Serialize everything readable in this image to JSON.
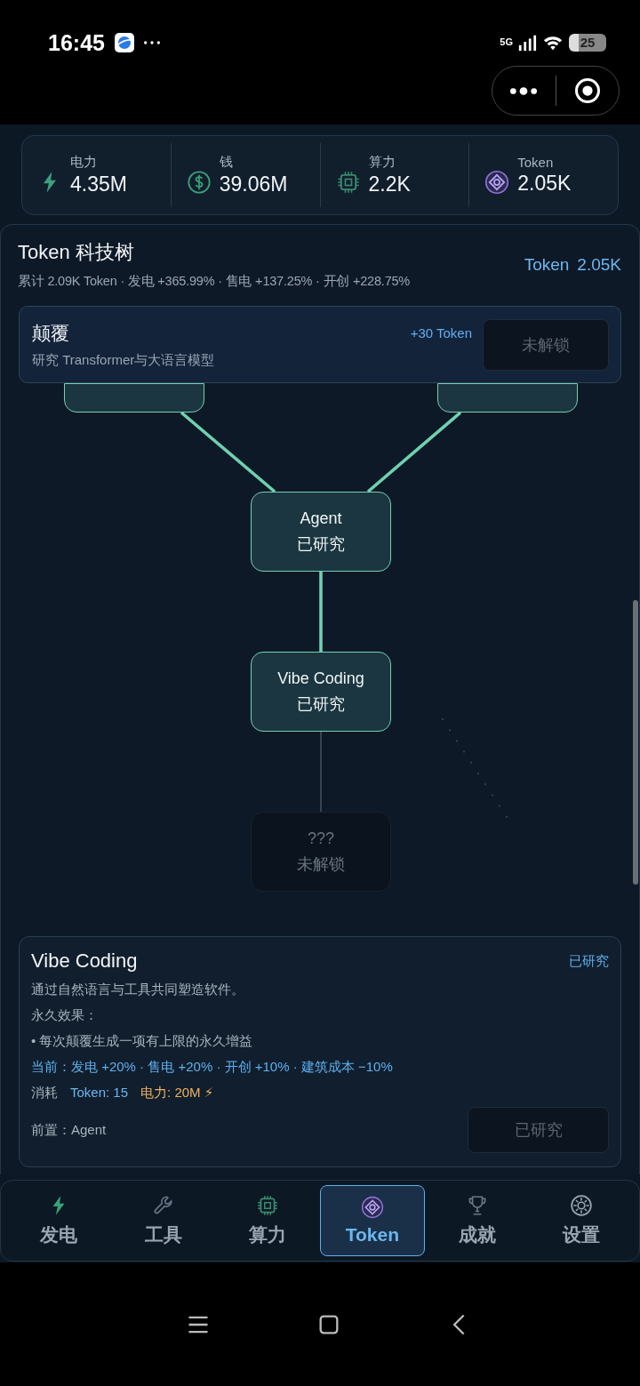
{
  "status_bar": {
    "time": "16:45",
    "network": "5G",
    "battery": "25"
  },
  "resources": [
    {
      "kind": "power",
      "label": "电力",
      "value": "4.35M"
    },
    {
      "kind": "money",
      "label": "钱",
      "value": "39.06M"
    },
    {
      "kind": "compute",
      "label": "算力",
      "value": "2.2K"
    },
    {
      "kind": "token",
      "label": "Token",
      "value": "2.05K"
    }
  ],
  "panel": {
    "title": "Token 科技树",
    "stats": "累计 2.09K Token · 发电 +365.99% · 售电 +137.25% · 开创 +228.75%",
    "balance_label": "Token",
    "balance_value": "2.05K"
  },
  "banner": {
    "title": "颠覆",
    "subtitle": "研究 Transformer与大语言模型",
    "reward": "+30 Token",
    "button": "未解锁",
    "disabled": true
  },
  "tree": {
    "nodes": [
      {
        "researched": true
      },
      {
        "researched": true
      },
      {
        "name": "Agent",
        "status": "已研究",
        "researched": true
      },
      {
        "name": "Vibe Coding",
        "status": "已研究",
        "researched": true
      },
      {
        "name": "???",
        "status": "未解锁",
        "researched": false
      }
    ],
    "edges": [
      {
        "active": true
      },
      {
        "active": true
      },
      {
        "active": true
      },
      {
        "active": false
      }
    ]
  },
  "detail": {
    "title": "Vibe Coding",
    "status": "已研究",
    "description": "通过自然语言与工具共同塑造软件。",
    "effects_label": "永久效果：",
    "effect": "• 每次颠覆生成一项有上限的永久增益",
    "current": "当前：发电 +20% · 售电 +20% · 开创 +10% · 建筑成本 −10%",
    "cost_label": "消耗",
    "costs": [
      {
        "kind": "token",
        "text": "Token: 15"
      },
      {
        "kind": "power",
        "text": "电力: 20M ⚡"
      }
    ],
    "prereq": "前置：Agent",
    "button": "已研究",
    "disabled": true
  },
  "nav": [
    {
      "kind": "power",
      "label": "发电",
      "selected": false
    },
    {
      "kind": "tools",
      "label": "工具",
      "selected": false
    },
    {
      "kind": "compute",
      "label": "算力",
      "selected": false
    },
    {
      "kind": "token",
      "label": "Token",
      "selected": true
    },
    {
      "kind": "trophy",
      "label": "成就",
      "selected": false
    },
    {
      "kind": "settings",
      "label": "设置",
      "selected": false
    }
  ]
}
